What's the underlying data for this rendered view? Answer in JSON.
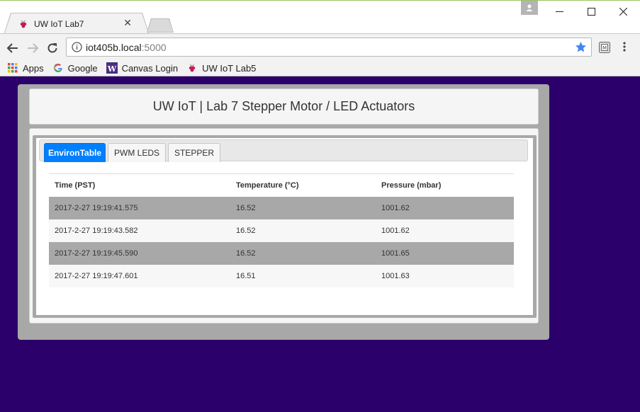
{
  "browser": {
    "tab_title": "UW IoT Lab7",
    "url_host": "iot405b.local",
    "url_port": ":5000",
    "bookmarks": [
      {
        "label": "Apps",
        "icon": "apps-grid-icon"
      },
      {
        "label": "Google",
        "icon": "google-icon"
      },
      {
        "label": "Canvas Login",
        "icon": "uw-w-icon"
      },
      {
        "label": "UW IoT Lab5",
        "icon": "raspberry-icon"
      }
    ]
  },
  "page": {
    "title": "UW IoT | Lab 7 Stepper Motor / LED Actuators",
    "tabs": [
      {
        "label": "EnvironTable",
        "active": true
      },
      {
        "label": "PWM LEDS",
        "active": false
      },
      {
        "label": "STEPPER",
        "active": false
      }
    ],
    "table": {
      "headers": [
        "Time (PST)",
        "Temperature (°C)",
        "Pressure (mbar)"
      ],
      "rows": [
        [
          "2017-2-27 19:19:41.575",
          "16.52",
          "1001.62"
        ],
        [
          "2017-2-27 19:19:43.582",
          "16.52",
          "1001.62"
        ],
        [
          "2017-2-27 19:19:45.590",
          "16.52",
          "1001.65"
        ],
        [
          "2017-2-27 19:19:47.601",
          "16.51",
          "1001.63"
        ]
      ]
    }
  },
  "colors": {
    "page_background": "#2c006a",
    "active_tab": "#007fff",
    "card_frame": "#a8a8a8"
  }
}
